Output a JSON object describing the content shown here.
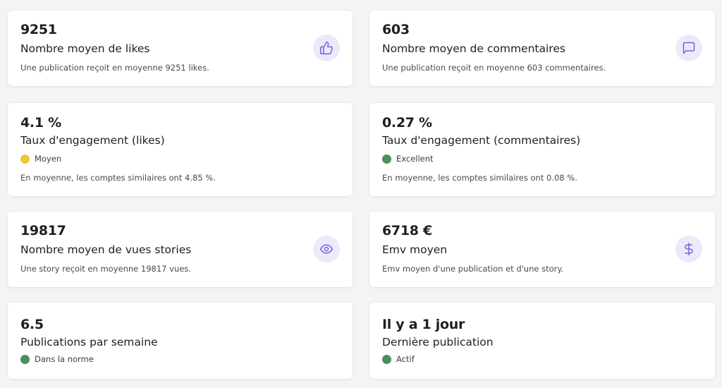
{
  "colors": {
    "icon_bg": "#ece9fb",
    "icon_stroke": "#6f64d8",
    "status_average": "#f0c53a",
    "status_good": "#4c8f5d"
  },
  "cards": [
    {
      "id": "likes",
      "value": "9251",
      "label": "Nombre moyen de likes",
      "description": "Une publication reçoit en moyenne 9251 likes.",
      "icon": "thumbs-up-icon"
    },
    {
      "id": "comments",
      "value": "603",
      "label": "Nombre moyen de commentaires",
      "description": "Une publication reçoit en moyenne 603 commentaires.",
      "icon": "comment-icon"
    },
    {
      "id": "engagement-likes",
      "value": "4.1 %",
      "label": "Taux d'engagement (likes)",
      "status": "Moyen",
      "status_color": "#f0c53a",
      "description": "En moyenne, les comptes similaires ont 4.85 %."
    },
    {
      "id": "engagement-comments",
      "value": "0.27 %",
      "label": "Taux d'engagement (commentaires)",
      "status": "Excellent",
      "status_color": "#4c8f5d",
      "description": "En moyenne, les comptes similaires ont 0.08 %."
    },
    {
      "id": "story-views",
      "value": "19817",
      "label": "Nombre moyen de vues stories",
      "description": "Une story reçoit en moyenne 19817 vues.",
      "icon": "eye-icon"
    },
    {
      "id": "emv",
      "value": "6718 €",
      "label": "Emv moyen",
      "description": "Emv moyen d'une publication et d'une story.",
      "icon": "dollar-icon"
    },
    {
      "id": "posts-per-week",
      "value": "6.5",
      "label": "Publications par semaine",
      "status": "Dans la norme",
      "status_color": "#4c8f5d"
    },
    {
      "id": "last-post",
      "value": "Il y a 1 jour",
      "label": "Dernière publication",
      "status": "Actif",
      "status_color": "#4c8f5d"
    }
  ]
}
